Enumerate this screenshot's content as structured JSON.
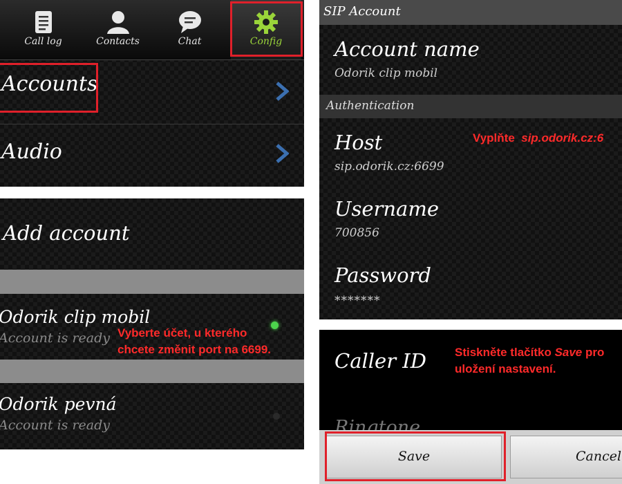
{
  "config_screen": {
    "tabs": [
      {
        "label": "Call log",
        "icon": "call-log-icon"
      },
      {
        "label": "Contacts",
        "icon": "contacts-icon"
      },
      {
        "label": "Chat",
        "icon": "chat-icon"
      },
      {
        "label": "Config",
        "icon": "gear-icon"
      }
    ],
    "active_tab": "Config",
    "active_color": "#9ad43a",
    "menu": [
      {
        "label": "Accounts"
      },
      {
        "label": "Audio"
      }
    ]
  },
  "accounts_screen": {
    "add_account_label": "Add account",
    "accounts": [
      {
        "name": "Odorik clip mobil",
        "status": "Account is ready",
        "indicator": "green"
      },
      {
        "name": "Odorik pevná",
        "status": "Account is ready",
        "indicator": "off"
      }
    ],
    "note": {
      "line1": "Vyberte účet, u kterého",
      "line2": "chcete změnit port na 6699."
    }
  },
  "sip_account": {
    "title": "SIP Account",
    "account_name_label": "Account name",
    "account_name_value": "Odorik clip mobil",
    "section_label": "Authentication",
    "host_label": "Host",
    "host_value": "sip.odorik.cz:6699",
    "username_label": "Username",
    "username_value": "700856",
    "password_label": "Password",
    "password_value": "*******",
    "host_note_prefix": "Vyplňte",
    "host_note_value": "sip.odorik.cz:6"
  },
  "save_screen": {
    "caller_id_label": "Caller ID",
    "partial_label": "Ringtone",
    "note": {
      "line1_prefix": "Stiskněte tlačítko",
      "line1_em": "Save",
      "line1_suffix": "pro",
      "line2": "uložení nastavení."
    },
    "save_label": "Save",
    "cancel_label": "Cancel"
  },
  "colors": {
    "annotation_red": "#e0202a",
    "chevron_blue": "#3b6fb0",
    "ready_green": "#4cd64c"
  }
}
